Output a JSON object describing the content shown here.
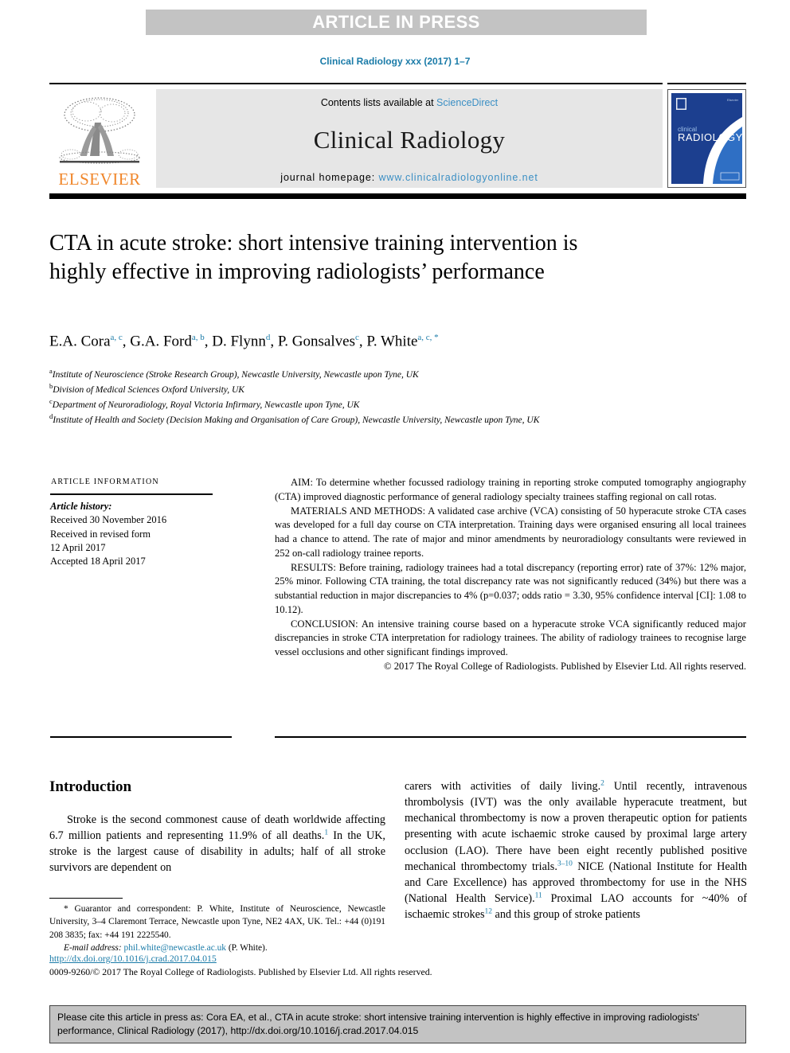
{
  "banner": {
    "text": "ARTICLE IN PRESS"
  },
  "journal_ref": "Clinical Radiology xxx (2017) 1–7",
  "masthead": {
    "publisher_name": "ELSEVIER",
    "contents_prefix": "Contents lists available at ",
    "contents_link": "ScienceDirect",
    "journal_name": "Clinical Radiology",
    "homepage_prefix": "journal homepage: ",
    "homepage_link": "www.clinicalradiologyonline.net",
    "cover_title_small": "clinical",
    "cover_title_large": "RADIOLOGY",
    "cover_color": "#1c3f8f"
  },
  "article": {
    "title": "CTA in acute stroke: short intensive training intervention is highly effective in improving radiologists’ performance",
    "authors_display": "E.A. Cora, G.A. Ford, D. Flynn, P. Gonsalves, P. White",
    "authors": [
      {
        "name": "E.A. Cora",
        "sup": "a, c"
      },
      {
        "name": "G.A. Ford",
        "sup": "a, b"
      },
      {
        "name": "D. Flynn",
        "sup": "d"
      },
      {
        "name": "P. Gonsalves",
        "sup": "c"
      },
      {
        "name": "P. White",
        "sup": "a, c, *"
      }
    ],
    "affiliations": [
      {
        "marker": "a",
        "text": "Institute of Neuroscience (Stroke Research Group), Newcastle University, Newcastle upon Tyne, UK"
      },
      {
        "marker": "b",
        "text": "Division of Medical Sciences Oxford University, UK"
      },
      {
        "marker": "c",
        "text": "Department of Neuroradiology, Royal Victoria Infirmary, Newcastle upon Tyne, UK"
      },
      {
        "marker": "d",
        "text": "Institute of Health and Society (Decision Making and Organisation of Care Group), Newcastle University, Newcastle upon Tyne, UK"
      }
    ]
  },
  "article_info": {
    "heading": "Article information",
    "history_label": "Article history:",
    "received": "Received 30 November 2016",
    "revised_label": "Received in revised form",
    "revised_date": "12 April 2017",
    "accepted": "Accepted 18 April 2017"
  },
  "abstract": {
    "aim": "AIM: To determine whether focussed radiology training in reporting stroke computed tomography angiography (CTA) improved diagnostic performance of general radiology specialty trainees staffing regional on call rotas.",
    "materials": "MATERIALS AND METHODS: A validated case archive (VCA) consisting of 50 hyperacute stroke CTA cases was developed for a full day course on CTA interpretation. Training days were organised ensuring all local trainees had a chance to attend. The rate of major and minor amendments by neuroradiology consultants were reviewed in 252 on-call radiology trainee reports.",
    "results": "RESULTS: Before training, radiology trainees had a total discrepancy (reporting error) rate of 37%: 12% major, 25% minor. Following CTA training, the total discrepancy rate was not significantly reduced (34%) but there was a substantial reduction in major discrepancies to 4% (p=0.037; odds ratio = 3.30, 95% confidence interval [CI]: 1.08 to 10.12).",
    "conclusion": "CONCLUSION: An intensive training course based on a hyperacute stroke VCA significantly reduced major discrepancies in stroke CTA interpretation for radiology trainees. The ability of radiology trainees to recognise large vessel occlusions and other significant findings improved.",
    "copyright": "© 2017 The Royal College of Radiologists. Published by Elsevier Ltd. All rights reserved."
  },
  "introduction": {
    "heading": "Introduction",
    "left_para_1": "Stroke is the second commonest cause of death worldwide affecting 6.7 million patients and representing 11.9% of all deaths.",
    "left_ref_1": "1",
    "left_para_1b": " In the UK, stroke is the largest cause of disability in adults; half of all stroke survivors are dependent on",
    "right_a": "carers with activities of daily living.",
    "right_ref_2": "2",
    "right_b": " Until recently, intravenous thrombolysis (IVT) was the only available hyperacute treatment, but mechanical thrombectomy is now a proven therapeutic option for patients presenting with acute ischaemic stroke caused by proximal large artery occlusion (LAO). There have been eight recently published positive mechanical thrombectomy trials.",
    "right_ref_3": "3–10",
    "right_c": " NICE (National Institute for Health and Care Excellence) has approved thrombectomy for use in the NHS (National Health Service).",
    "right_ref_11": "11",
    "right_d": " Proximal LAO accounts for ~40% of ischaemic strokes",
    "right_ref_12": "12",
    "right_e": " and this group of stroke patients"
  },
  "footnote": {
    "correspondence": "* Guarantor and correspondent: P. White, Institute of Neuroscience, Newcastle University, 3–4 Claremont Terrace, Newcastle upon Tyne, NE2 4AX, UK. Tel.: +44 (0)191 208 3835; fax: +44 191 2225540.",
    "email_label": "E-mail address:",
    "email": "phil.white@newcastle.ac.uk",
    "email_suffix": " (P. White).",
    "doi": "http://dx.doi.org/10.1016/j.crad.2017.04.015",
    "issn_line": "0009-9260/© 2017 The Royal College of Radiologists. Published by Elsevier Ltd. All rights reserved."
  },
  "cite_footer": {
    "text": "Please cite this article in press as: Cora EA, et al., CTA in acute stroke: short intensive training intervention is highly effective in improving radiologists' performance, Clinical Radiology (2017), http://dx.doi.org/10.1016/j.crad.2017.04.015"
  },
  "colors": {
    "link": "#1a7ba8",
    "sciencedirect_link": "#3b8fc4",
    "elsevier_orange": "#f0862a",
    "banner_gray": "#c3c3c3",
    "panel_gray": "#e6e6e6"
  }
}
